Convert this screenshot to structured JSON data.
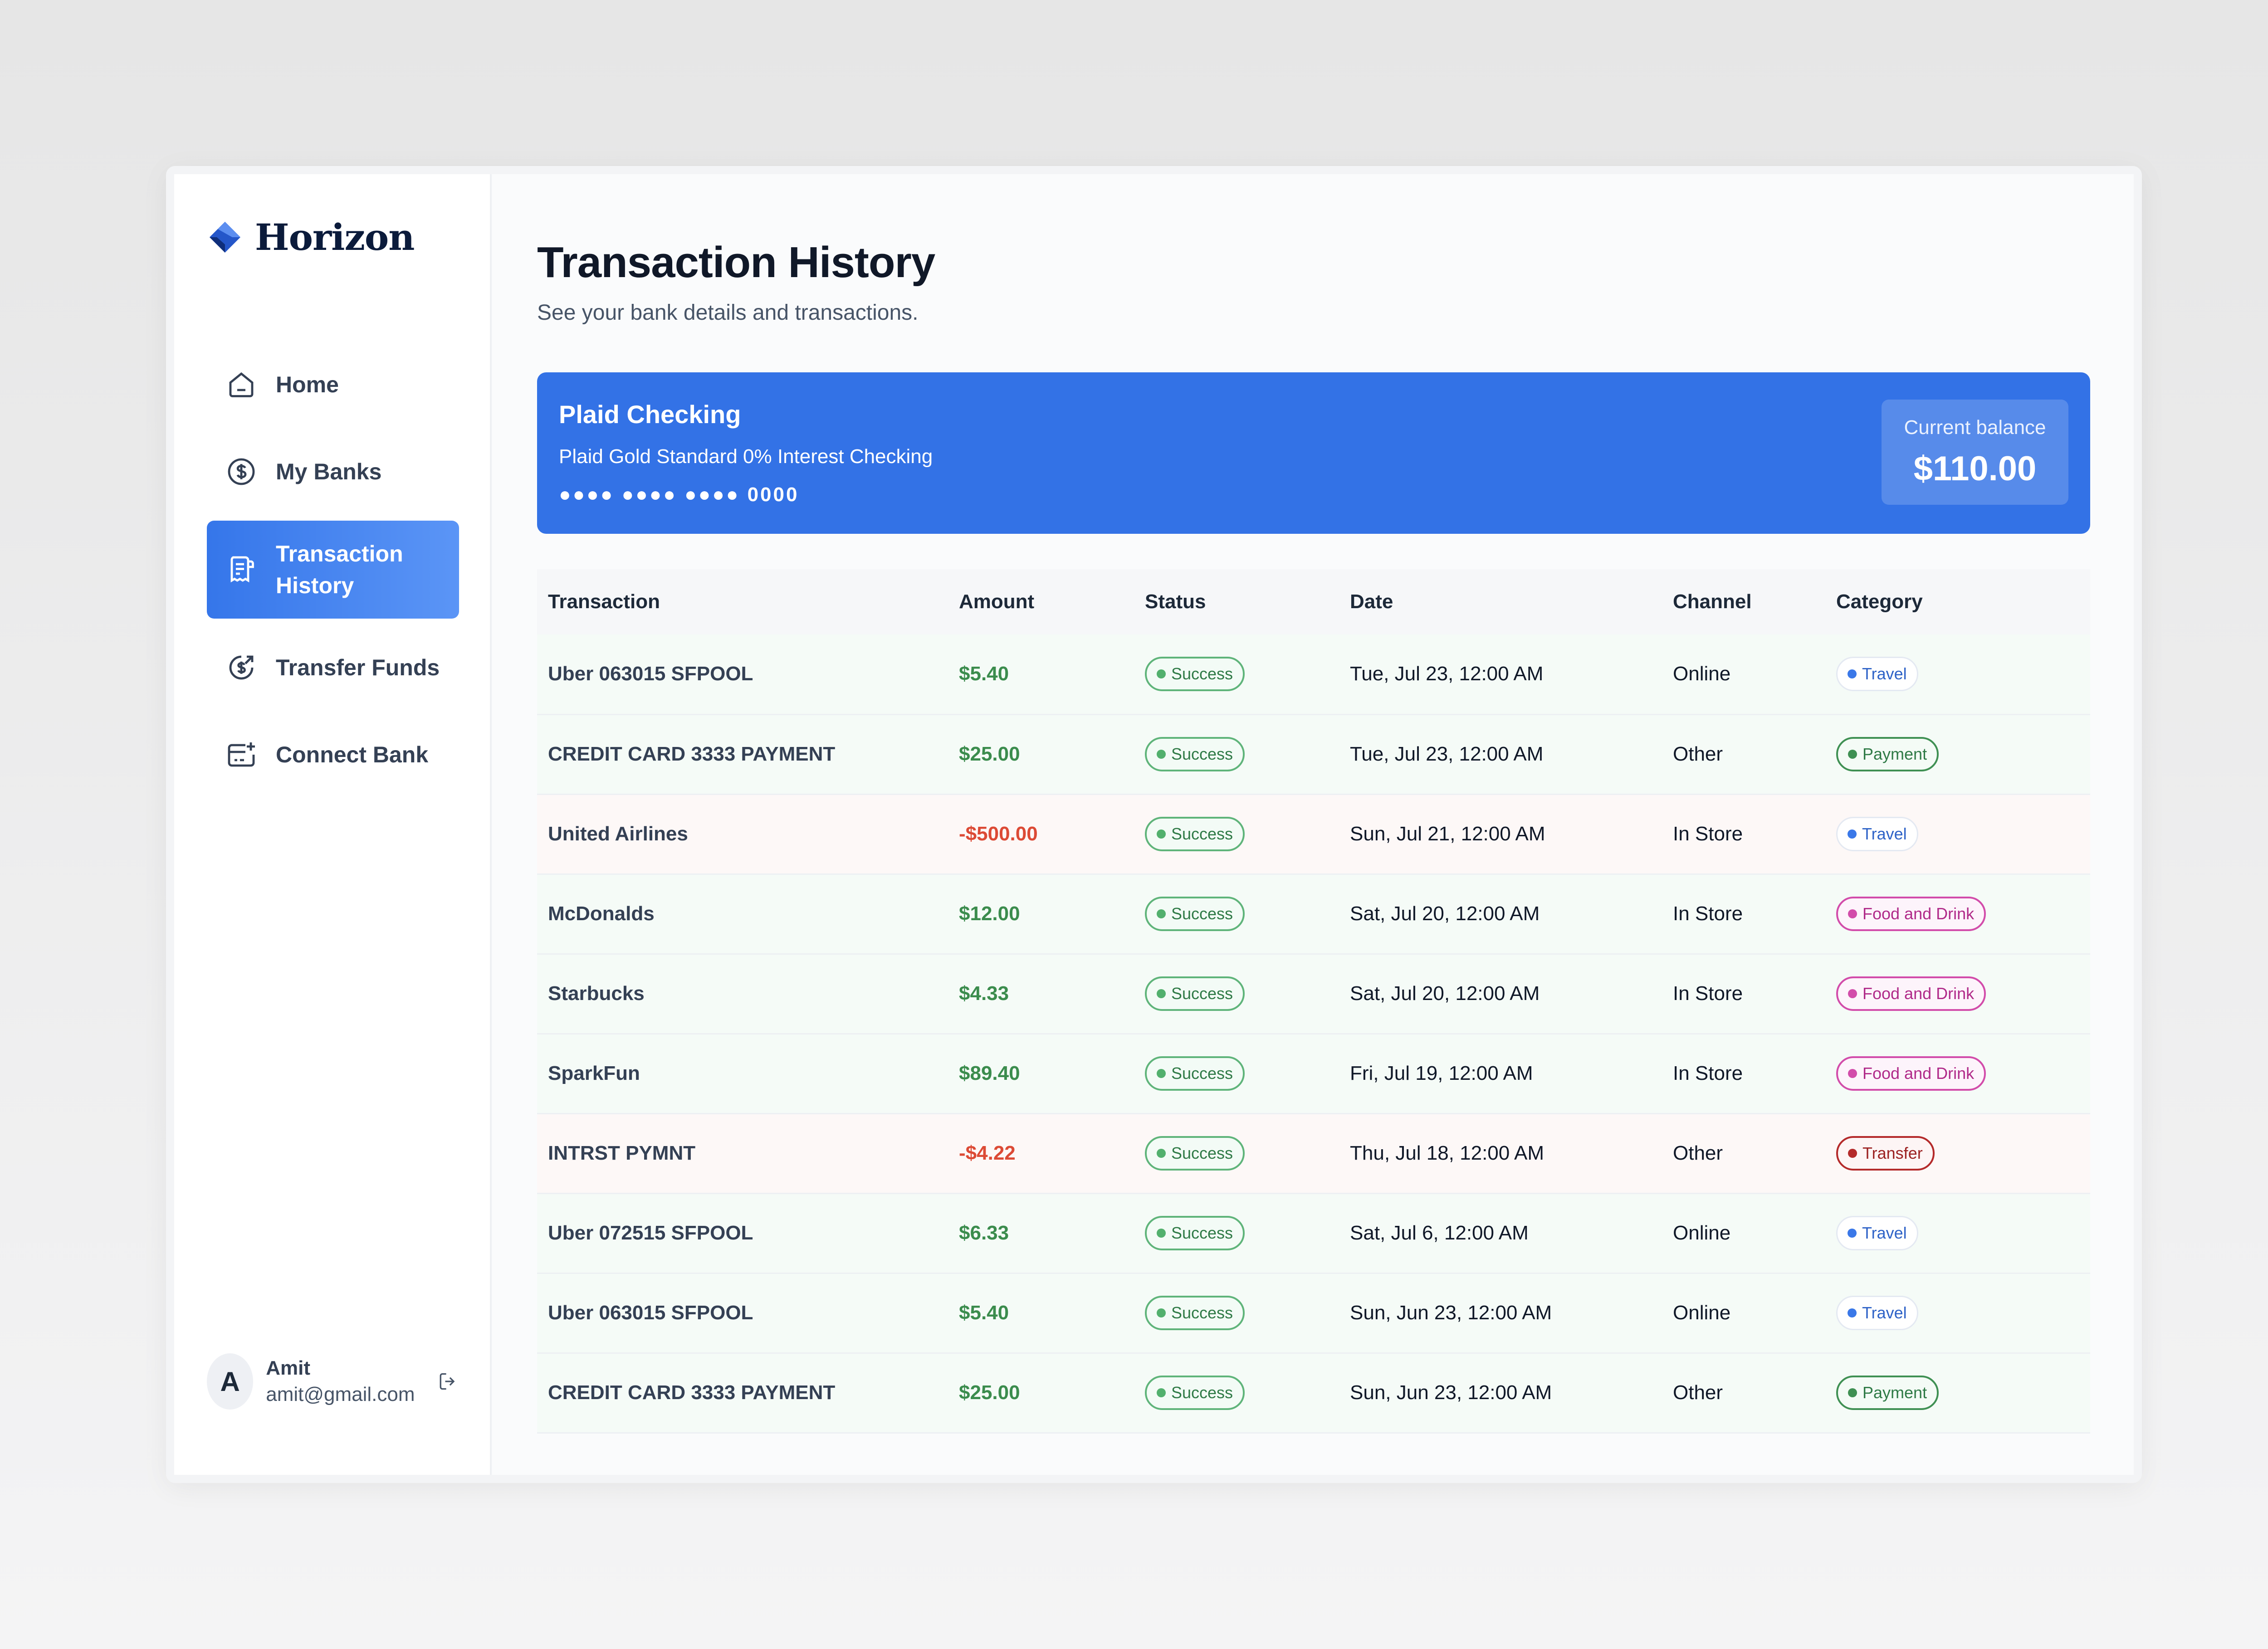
{
  "app": {
    "brand": "Horizon"
  },
  "sidebar": {
    "items": [
      {
        "label": "Home",
        "icon": "home-icon"
      },
      {
        "label": "My Banks",
        "icon": "dollar-circle-icon"
      },
      {
        "label": "Transaction History",
        "icon": "receipt-icon",
        "active": true
      },
      {
        "label": "Transfer Funds",
        "icon": "money-send-icon"
      },
      {
        "label": "Connect Bank",
        "icon": "card-add-icon"
      }
    ],
    "user": {
      "initial": "A",
      "name": "Amit",
      "email": "amit@gmail.com"
    }
  },
  "header": {
    "title": "Transaction History",
    "subtitle": "See your bank details and transactions."
  },
  "bank_card": {
    "name": "Plaid Checking",
    "official_name": "Plaid Gold Standard 0% Interest Checking",
    "mask": "●●●● ●●●● ●●●● 0000",
    "balance_label": "Current balance",
    "balance": "$110.00"
  },
  "table": {
    "columns": [
      "Transaction",
      "Amount",
      "Status",
      "Date",
      "Channel",
      "Category"
    ],
    "rows": [
      {
        "name": "Uber 063015 SFPOOL",
        "amount": "$5.40",
        "status": "Success",
        "date": "Tue, Jul 23, 12:00 AM",
        "channel": "Online",
        "category": "Travel"
      },
      {
        "name": "CREDIT CARD 3333 PAYMENT",
        "amount": "$25.00",
        "status": "Success",
        "date": "Tue, Jul 23, 12:00 AM",
        "channel": "Other",
        "category": "Payment"
      },
      {
        "name": "United Airlines",
        "amount": "-$500.00",
        "status": "Success",
        "date": "Sun, Jul 21, 12:00 AM",
        "channel": "In Store",
        "category": "Travel"
      },
      {
        "name": "McDonalds",
        "amount": "$12.00",
        "status": "Success",
        "date": "Sat, Jul 20, 12:00 AM",
        "channel": "In Store",
        "category": "Food and Drink"
      },
      {
        "name": "Starbucks",
        "amount": "$4.33",
        "status": "Success",
        "date": "Sat, Jul 20, 12:00 AM",
        "channel": "In Store",
        "category": "Food and Drink"
      },
      {
        "name": "SparkFun",
        "amount": "$89.40",
        "status": "Success",
        "date": "Fri, Jul 19, 12:00 AM",
        "channel": "In Store",
        "category": "Food and Drink"
      },
      {
        "name": "INTRST PYMNT",
        "amount": "-$4.22",
        "status": "Success",
        "date": "Thu, Jul 18, 12:00 AM",
        "channel": "Other",
        "category": "Transfer"
      },
      {
        "name": "Uber 072515 SFPOOL",
        "amount": "$6.33",
        "status": "Success",
        "date": "Sat, Jul 6, 12:00 AM",
        "channel": "Online",
        "category": "Travel"
      },
      {
        "name": "Uber 063015 SFPOOL",
        "amount": "$5.40",
        "status": "Success",
        "date": "Sun, Jun 23, 12:00 AM",
        "channel": "Online",
        "category": "Travel"
      },
      {
        "name": "CREDIT CARD 3333 PAYMENT",
        "amount": "$25.00",
        "status": "Success",
        "date": "Sun, Jun 23, 12:00 AM",
        "channel": "Other",
        "category": "Payment"
      }
    ]
  },
  "colors": {
    "accent": "#3372e6",
    "positive": "#3b8c4d",
    "negative": "#dc4a35"
  }
}
